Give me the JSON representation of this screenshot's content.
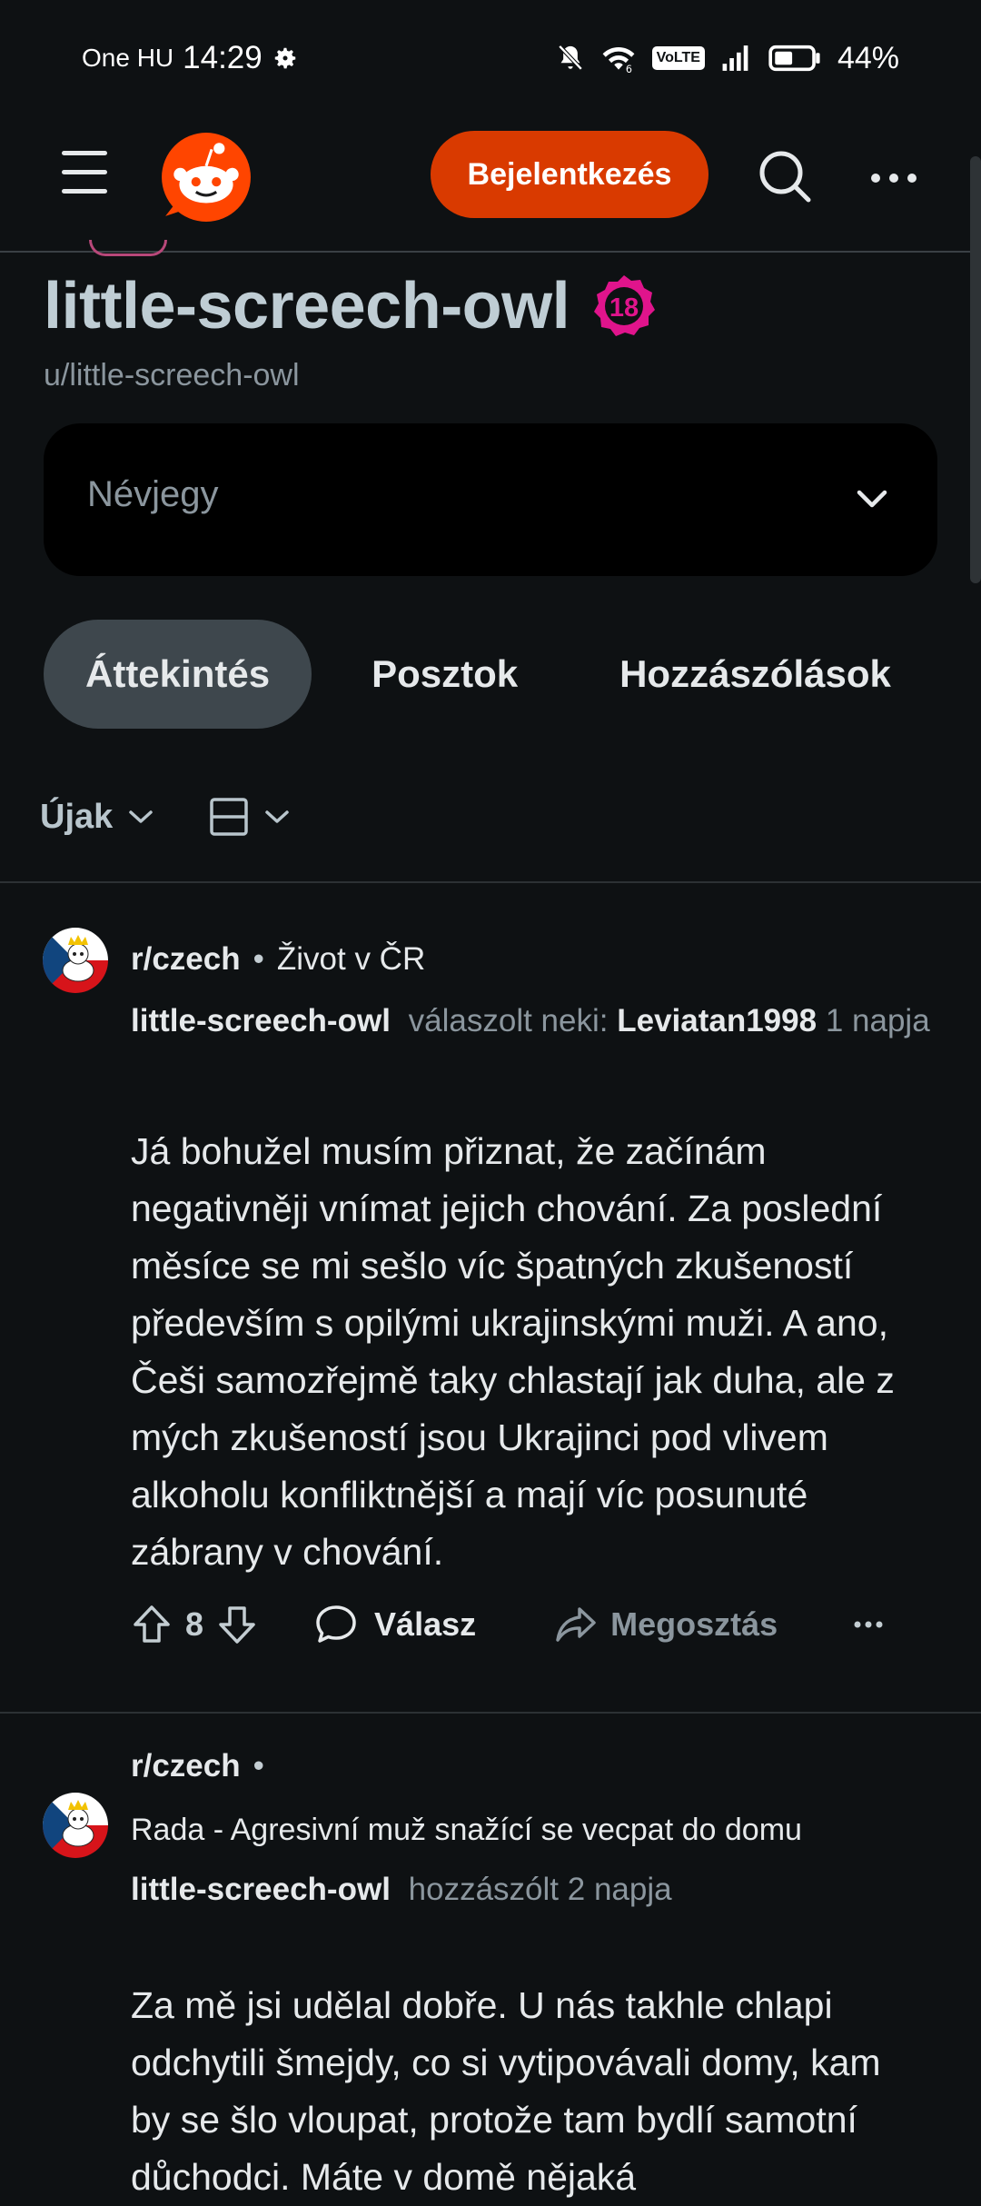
{
  "status_bar": {
    "carrier": "One HU",
    "time": "14:29",
    "volte": "VoLTE",
    "battery": "44%"
  },
  "header": {
    "login_label": "Bejelentkezés",
    "icons": [
      "menu-icon",
      "reddit-logo",
      "search-icon",
      "more-icon"
    ],
    "login_color": "#d93a00"
  },
  "profile": {
    "display_name": "little-screech-owl",
    "nsfw_badge": "18",
    "handle": "u/little-screech-owl",
    "about_label": "Névjegy"
  },
  "tabs": [
    {
      "label": "Áttekintés",
      "active": true
    },
    {
      "label": "Posztok",
      "active": false
    },
    {
      "label": "Hozzászólások",
      "active": false
    }
  ],
  "sort": {
    "label": "Újak"
  },
  "comments": [
    {
      "subreddit": "r/czech",
      "separator": "•",
      "post_title": "Život v ČR",
      "author": "little-screech-owl",
      "action": "válaszolt neki:",
      "reply_to": "Leviatan1998",
      "time": "1 napja",
      "body": "Já bohužel musím přiznat, že začínám negativněji vnímat jejich chování. Za poslední měsíce se mi sešlo víc špatných zkušeností především s opilými ukrajinskými muži. A ano, Češi samozřejmě taky chlastají jak duha, ale z mých zkušeností jsou Ukrajinci pod vlivem alkoholu konfliktnější a mají víc posunuté zábrany v chování.",
      "votes": "8",
      "reply_label": "Válasz",
      "share_label": "Megosztás"
    },
    {
      "subreddit": "r/czech",
      "separator": "•",
      "post_title": "Rada - Agresivní muž snažící se vecpat do domu",
      "author": "little-screech-owl",
      "action": "hozzászólt",
      "time": "2 napja",
      "body": "Za mě jsi udělal dobře. U nás takhle chlapi odchytili šmejdy, co si vytipovávali domy, kam by se šlo vloupat, protože tam bydlí samotní důchodci. Máte v domě nějaká"
    }
  ]
}
